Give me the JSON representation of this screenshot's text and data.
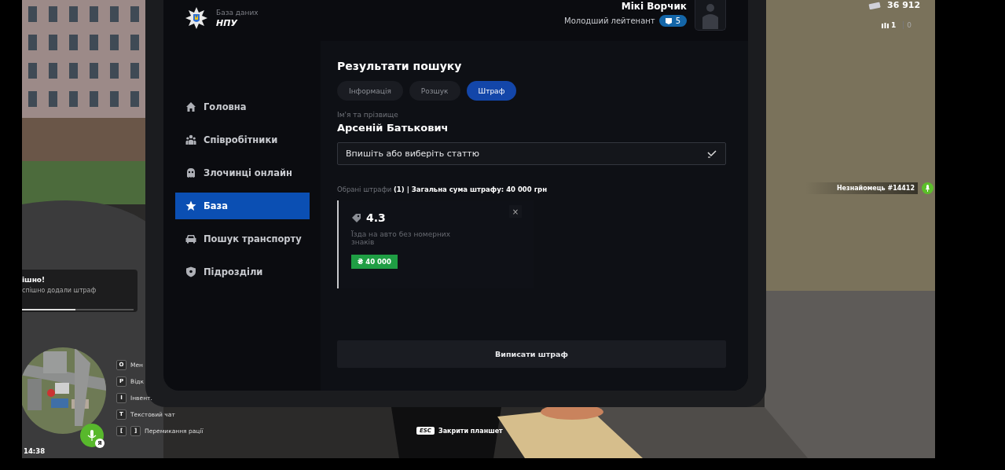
{
  "hud": {
    "money": "36 912",
    "ammo": "1",
    "ammo_reserve": "0",
    "nametag": "Незнайомець #14412",
    "time": "14:38",
    "mic_badge": "Я",
    "notification": {
      "title": "ішно!",
      "message": "спішно додали штраф",
      "level": 0.48
    },
    "keybinds": [
      {
        "keys": [
          "O"
        ],
        "label": "Мен"
      },
      {
        "keys": [
          "P"
        ],
        "label": "Відк"
      },
      {
        "keys": [
          "I"
        ],
        "label": "Інвент."
      },
      {
        "keys": [
          "T"
        ],
        "label": "Текстовий чат"
      },
      {
        "keys": [
          "[",
          "]"
        ],
        "label": "Перемикання рації"
      }
    ],
    "close_hint": {
      "key": "ESC",
      "label": "Закрити планшет"
    }
  },
  "tablet": {
    "brand": {
      "caption": "База даних",
      "name": "НПУ"
    },
    "user": {
      "name": "Мікі Ворчик",
      "rank": "Молодший лейтенант",
      "rank_badge": "5"
    },
    "sidebar": {
      "items": [
        {
          "label": "Головна",
          "kind": "home",
          "selected": false
        },
        {
          "label": "Співробітники",
          "kind": "people",
          "selected": false
        },
        {
          "label": "Злочинці онлайн",
          "kind": "mask",
          "selected": false
        },
        {
          "label": "База",
          "kind": "star",
          "selected": true
        },
        {
          "label": "Пошук транспорту",
          "kind": "car",
          "selected": false
        },
        {
          "label": "Підрозділи",
          "kind": "shield",
          "selected": false
        }
      ]
    },
    "content": {
      "title": "Результати пошуку",
      "tabs": [
        {
          "label": "Інформація",
          "selected": false
        },
        {
          "label": "Розшук",
          "selected": false
        },
        {
          "label": "Штраф",
          "selected": true
        }
      ],
      "name_label": "Ім'я та прізвище",
      "name": "Арсеній Батькович",
      "article_select": {
        "placeholder": "Впишіть або виберіть статтю"
      },
      "summary": "Обрані штрафи **(1) | Загальна сума штрафу: 40 000 грн**",
      "fines": [
        {
          "code": "4.3",
          "description": "Їзда на авто без номерних знаків",
          "amount": "₴ 40 000",
          "close": "×"
        }
      ],
      "submit": "Виписати штраф"
    }
  }
}
